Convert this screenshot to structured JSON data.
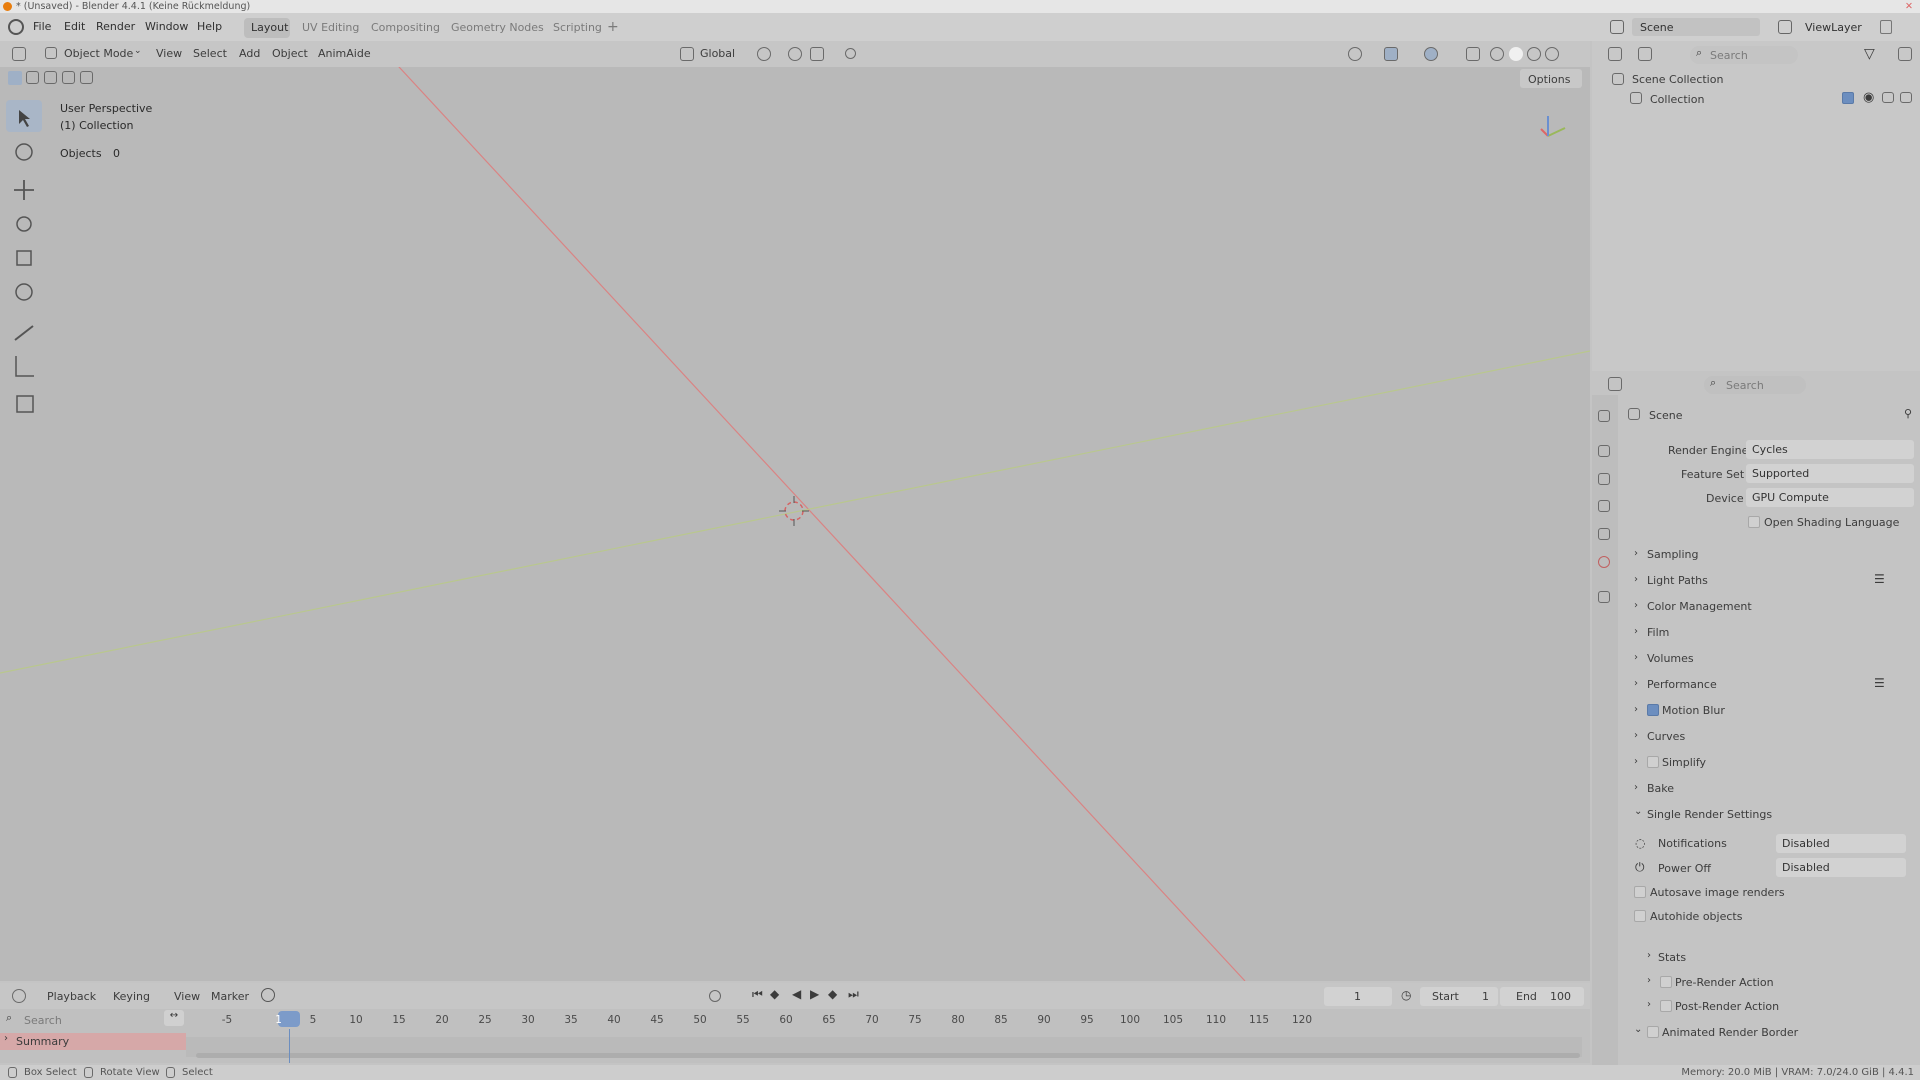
{
  "titlebar": {
    "title": "* (Unsaved) - Blender 4.4.1 (Keine Rückmeldung)"
  },
  "menubar": {
    "menus": [
      "File",
      "Edit",
      "Render",
      "Window",
      "Help"
    ],
    "workspaces": [
      "Layout",
      "UV Editing",
      "Compositing",
      "Geometry Nodes",
      "Scripting"
    ],
    "add_tab": "+",
    "scene_label": "Scene",
    "viewlayer_label": "ViewLayer"
  },
  "viewport": {
    "mode": "Object Mode",
    "menus": [
      "View",
      "Select",
      "Add",
      "Object",
      "AnimAide"
    ],
    "transform_orientation": "Global",
    "options": "Options",
    "info_perspective": "User Perspective",
    "info_collection": "(1) Collection",
    "objects_label": "Objects",
    "objects_count": "0"
  },
  "outliner": {
    "search_placeholder": "Search",
    "scene_collection": "Scene Collection",
    "collection": "Collection"
  },
  "properties": {
    "search_placeholder": "Search",
    "context": "Scene",
    "render_engine_label": "Render Engine",
    "render_engine": "Cycles",
    "feature_set_label": "Feature Set",
    "feature_set": "Supported",
    "device_label": "Device",
    "device": "GPU Compute",
    "osl_label": "Open Shading Language",
    "panels": [
      "Sampling",
      "Light Paths",
      "Color Management",
      "Film",
      "Volumes",
      "Performance",
      "Motion Blur",
      "Curves",
      "Simplify",
      "Bake",
      "Single Render Settings"
    ],
    "notifications_label": "Notifications",
    "notifications_value": "Disabled",
    "poweroff_label": "Power Off",
    "poweroff_value": "Disabled",
    "autosave_label": "Autosave image renders",
    "autohide_label": "Autohide objects",
    "sub_panels": [
      "Stats",
      "Pre-Render Action",
      "Post-Render Action"
    ],
    "animated_border": "Animated Render Border"
  },
  "timeline": {
    "menus": [
      "Playback",
      "Keying",
      "View",
      "Marker"
    ],
    "current_frame": "1",
    "start_label": "Start",
    "start_value": "1",
    "end_label": "End",
    "end_value": "100",
    "search_placeholder": "Search",
    "summary": "Summary",
    "ticks": [
      "-5",
      "1",
      "5",
      "10",
      "15",
      "20",
      "25",
      "30",
      "35",
      "40",
      "45",
      "50",
      "55",
      "60",
      "65",
      "70",
      "75",
      "80",
      "85",
      "90",
      "95",
      "100",
      "105",
      "110",
      "115",
      "120"
    ]
  },
  "statusbar": {
    "box_select": "Box Select",
    "rotate_view": "Rotate View",
    "select": "Select",
    "memory": "Memory: 20.0 MiB | VRAM: 7.0/24.0 GiB | 4.4.1"
  },
  "colors": {
    "x_axis": "#e07a7a",
    "y_axis": "#b9c98a",
    "active_tool": "#a9b6c7",
    "summary_bar": "#d6a8a8"
  }
}
